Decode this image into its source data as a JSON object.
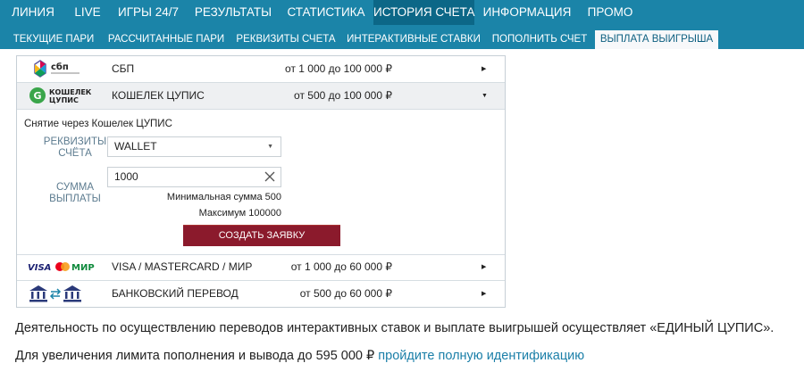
{
  "top_nav": [
    {
      "label": "Линия",
      "active": false
    },
    {
      "label": "Live",
      "active": false
    },
    {
      "label": "Игры 24/7",
      "active": false
    },
    {
      "label": "Результаты",
      "active": false
    },
    {
      "label": "Статистика",
      "active": false
    },
    {
      "label": "История счета",
      "active": true
    },
    {
      "label": "Информация",
      "active": false
    },
    {
      "label": "Промо",
      "active": false
    }
  ],
  "sub_nav": [
    {
      "label": "Текущие пари",
      "active": false
    },
    {
      "label": "Рассчитанные пари",
      "active": false
    },
    {
      "label": "Реквизиты счета",
      "active": false
    },
    {
      "label": "Интерактивные ставки",
      "active": false
    },
    {
      "label": "Пополнить счет",
      "active": false
    },
    {
      "label": "Выплата выигрыша",
      "active": true
    }
  ],
  "methods": {
    "sbp": {
      "logo_text": "сбп",
      "name": "СБП",
      "limits": "от 1 000 до 100 000 ₽"
    },
    "tsupis": {
      "logo_line1": "КОШЕЛЕК",
      "logo_line2": "ЦУПИС",
      "name": "КОШЕЛЕК ЦУПИС",
      "limits": "от 500 до 100 000 ₽"
    },
    "card": {
      "logo_visa": "VISA",
      "logo_mir": "МИР",
      "name": "VISA / MASTERCARD / МИР",
      "limits": "от 1 000 до 60 000 ₽"
    },
    "bank": {
      "name": "БАНКОВСКИЙ ПЕРЕВОД",
      "limits": "от 500 до 60 000 ₽"
    }
  },
  "withdraw_form": {
    "title": "Снятие через Кошелек ЦУПИС",
    "requisites_label_1": "Реквизиты",
    "requisites_label_2": "счёта",
    "requisites_value": "WALLET",
    "amount_label_1": "Сумма",
    "amount_label_2": "выплаты",
    "amount_value": "1000",
    "min_note": "Минимальная сумма 500",
    "max_note": "Максимум 100000",
    "submit_label": "Создать заявку"
  },
  "info": {
    "line1": "Деятельность по осуществлению переводов интерактивных ставок и выплате выигрышей осуществляет «ЕДИНЫЙ ЦУПИС».",
    "line2_text": "Для увеличения лимита пополнения и вывода до 595 000 ₽",
    "line2_link": "пройдите полную идентификацию"
  },
  "colors": {
    "nav_bg": "#1b84a8",
    "nav_active": "#0c6787",
    "submit_bg": "#8b1a2c",
    "link": "#1b7fa8"
  }
}
